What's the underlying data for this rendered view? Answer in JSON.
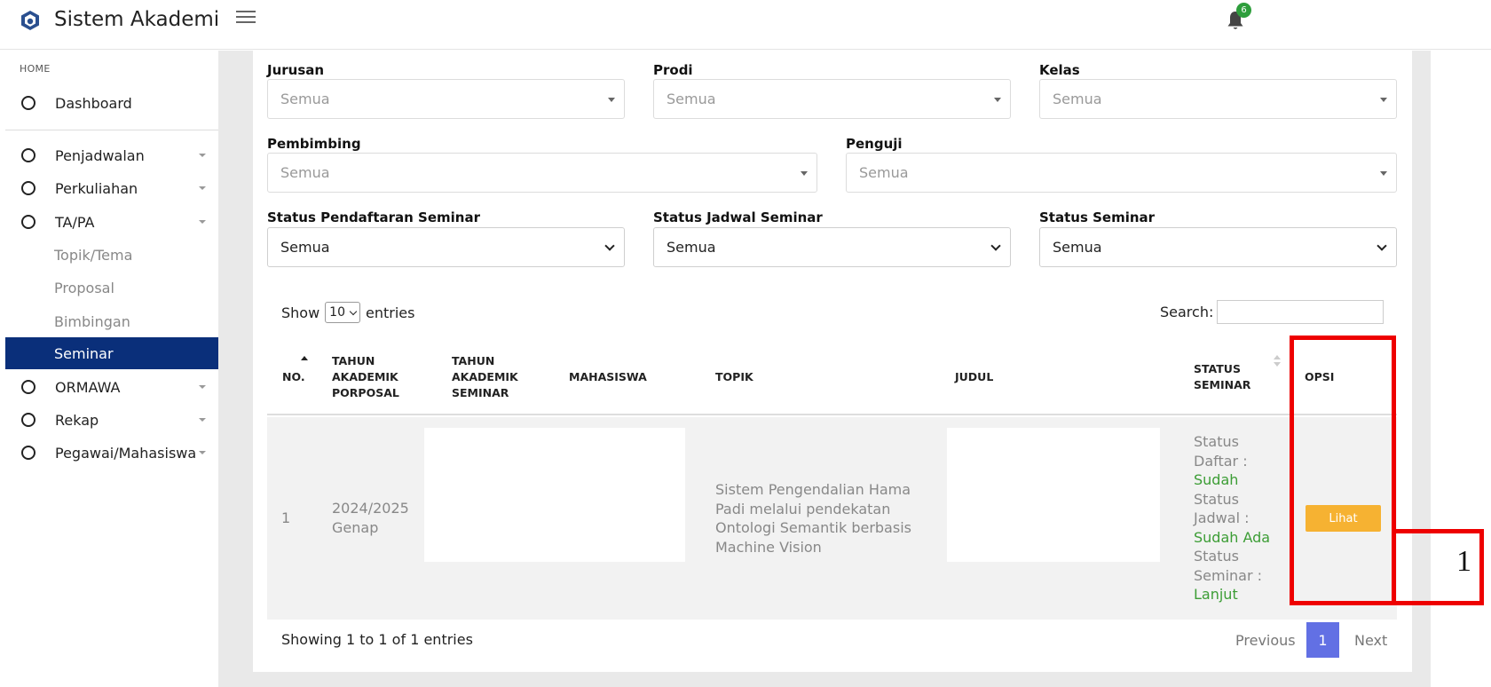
{
  "header": {
    "app_title": "Sistem Akademik",
    "notification_count": "6"
  },
  "sidebar": {
    "heading": "HOME",
    "items": [
      {
        "label": "Dashboard"
      },
      {
        "label": "Penjadwalan"
      },
      {
        "label": "Perkuliahan"
      },
      {
        "label": "TA/PA"
      },
      {
        "label": "ORMAWA"
      },
      {
        "label": "Rekap"
      },
      {
        "label": "Pegawai/Mahasiswa"
      }
    ],
    "sub_items": [
      {
        "label": "Topik/Tema"
      },
      {
        "label": "Proposal"
      },
      {
        "label": "Bimbingan"
      },
      {
        "label": "Seminar"
      }
    ]
  },
  "filters": {
    "jurusan": {
      "label": "Jurusan",
      "value": "Semua"
    },
    "prodi": {
      "label": "Prodi",
      "value": "Semua"
    },
    "kelas": {
      "label": "Kelas",
      "value": "Semua"
    },
    "pembimbing": {
      "label": "Pembimbing",
      "value": "Semua"
    },
    "penguji": {
      "label": "Penguji",
      "value": "Semua"
    },
    "status_pendaftaran": {
      "label": "Status Pendaftaran Seminar",
      "value": "Semua"
    },
    "status_jadwal": {
      "label": "Status Jadwal Seminar",
      "value": "Semua"
    },
    "status_seminar": {
      "label": "Status Seminar",
      "value": "Semua"
    }
  },
  "table_controls": {
    "show": "Show",
    "length": "10",
    "entries": "entries",
    "search_label": "Search:"
  },
  "table": {
    "headers": {
      "no": "NO.",
      "tahun_proposal": [
        "TAHUN",
        "AKADEMIK",
        "PORPOSAL"
      ],
      "tahun_seminar": [
        "TAHUN",
        "AKADEMIK",
        "SEMINAR"
      ],
      "mahasiswa": "MAHASISWA",
      "topik": "TOPIK",
      "judul": "JUDUL",
      "status_seminar": [
        "STATUS",
        "SEMINAR"
      ],
      "opsi": "OPSI"
    },
    "rows": [
      {
        "no": "1",
        "tahun": [
          "2024/2025",
          "Genap"
        ],
        "topik": [
          "Sistem Pengendalian Hama",
          "Padi melalui pendekatan",
          "Ontologi Semantik berbasis",
          "Machine Vision"
        ],
        "status": {
          "daftar_label": [
            "Status",
            "Daftar :"
          ],
          "daftar_value": "Sudah",
          "jadwal_label": [
            "Status",
            "Jadwal :"
          ],
          "jadwal_value": "Sudah Ada",
          "seminar_label": [
            "Status",
            "Seminar :"
          ],
          "seminar_value": "Lanjut"
        },
        "action": "Lihat"
      }
    ]
  },
  "footer": {
    "showing": "Showing 1 to 1 of 1 entries",
    "previous": "Previous",
    "page": "1",
    "next": "Next"
  },
  "annotation": {
    "label": "1",
    "color": "#ee0000"
  }
}
